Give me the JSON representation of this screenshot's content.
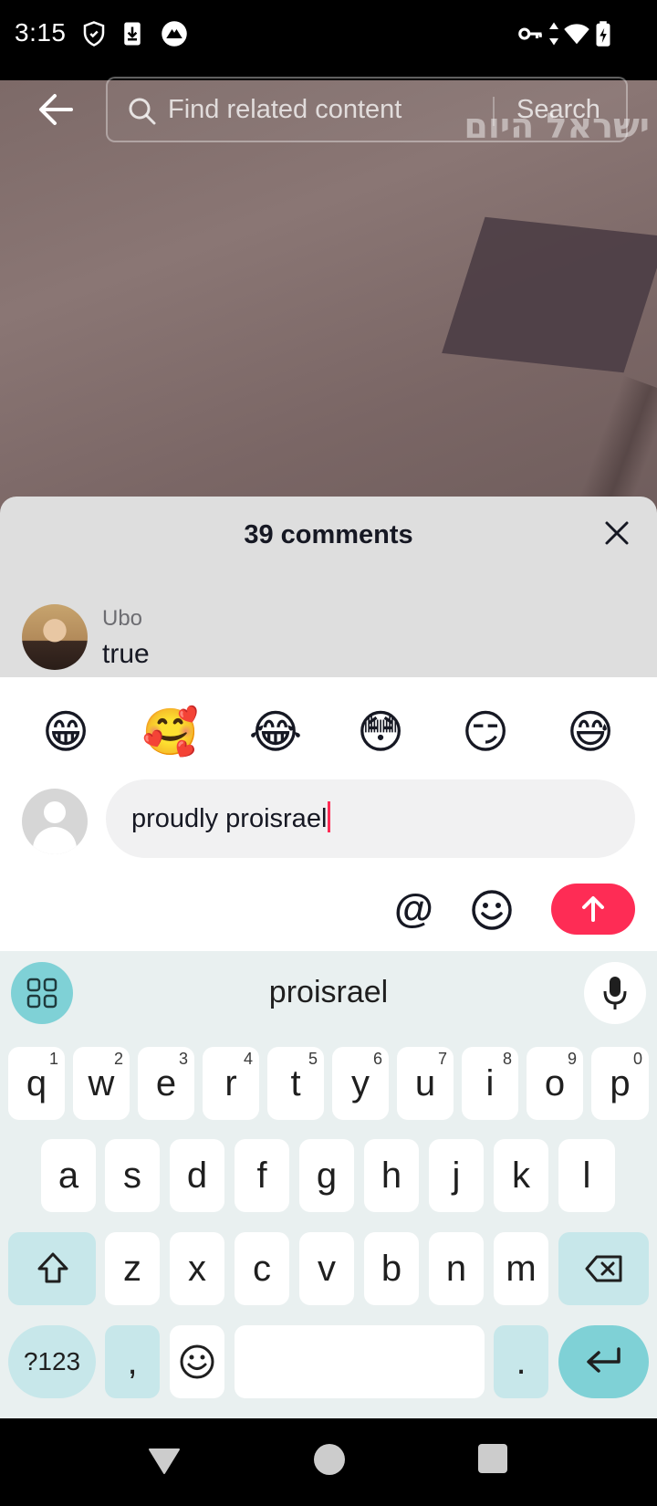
{
  "status_bar": {
    "time": "3:15"
  },
  "video": {
    "watermark": "ישראל היום"
  },
  "search": {
    "placeholder": "Find related content",
    "button_label": "Search"
  },
  "comments_sheet": {
    "title": "39 comments",
    "comment": {
      "username": "Ubo",
      "text": "true"
    }
  },
  "composer": {
    "quick_emojis": [
      "😁",
      "🥰",
      "😂",
      "😳",
      "😏",
      "😅"
    ],
    "input_value": "proudly proisrael",
    "mention_symbol": "@",
    "send_color": "#fe2c55"
  },
  "keyboard": {
    "suggestion": "proisrael",
    "row1": [
      {
        "key": "q",
        "hint": "1"
      },
      {
        "key": "w",
        "hint": "2"
      },
      {
        "key": "e",
        "hint": "3"
      },
      {
        "key": "r",
        "hint": "4"
      },
      {
        "key": "t",
        "hint": "5"
      },
      {
        "key": "y",
        "hint": "6"
      },
      {
        "key": "u",
        "hint": "7"
      },
      {
        "key": "i",
        "hint": "8"
      },
      {
        "key": "o",
        "hint": "9"
      },
      {
        "key": "p",
        "hint": "0"
      }
    ],
    "row2": [
      "a",
      "s",
      "d",
      "f",
      "g",
      "h",
      "j",
      "k",
      "l"
    ],
    "row3": [
      "z",
      "x",
      "c",
      "v",
      "b",
      "n",
      "m"
    ],
    "symbols_label": "?123",
    "comma_label": ",",
    "period_label": "."
  }
}
